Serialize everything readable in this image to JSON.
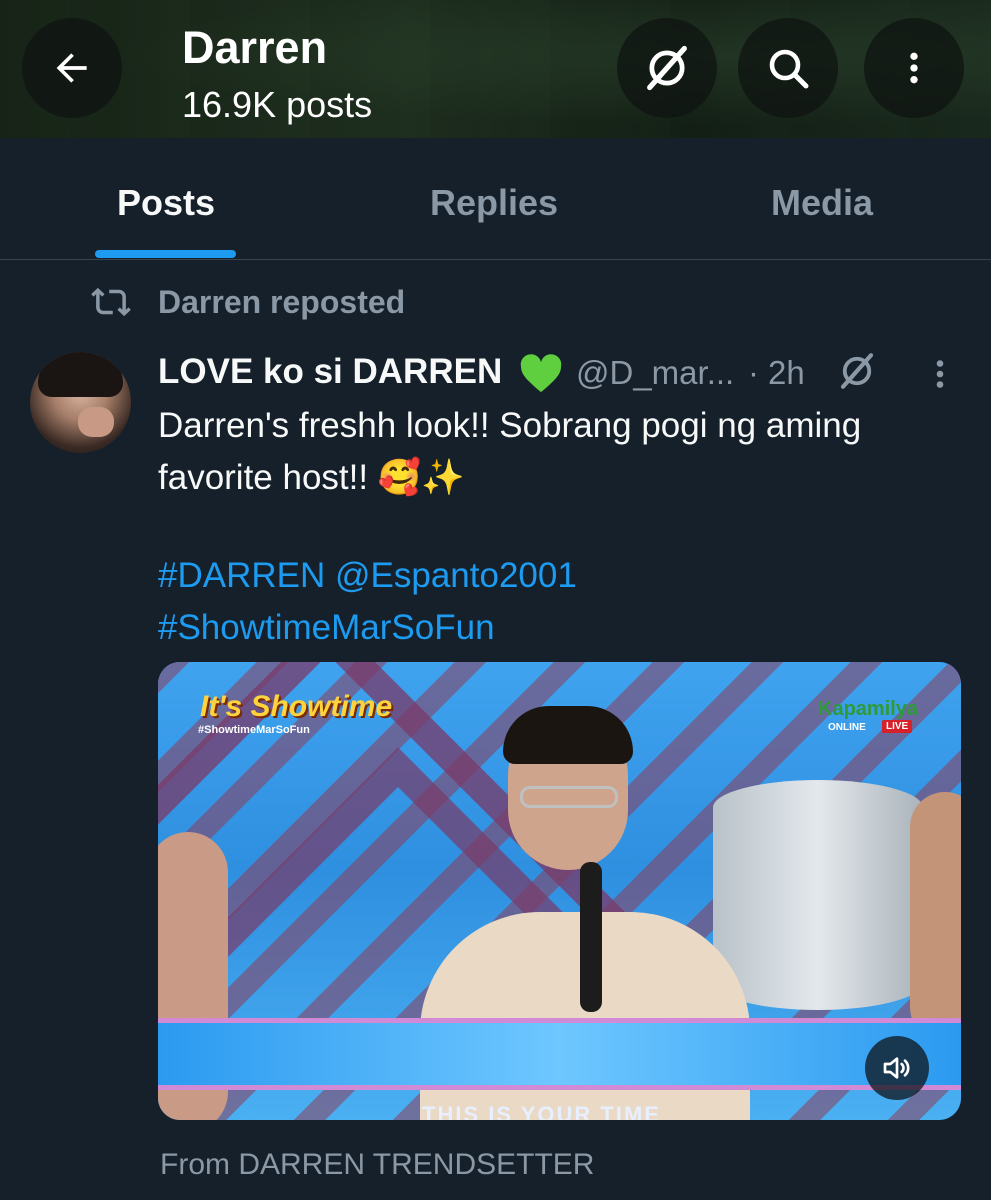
{
  "header": {
    "title": "Darren",
    "subtitle": "16.9K posts"
  },
  "tabs": [
    {
      "label": "Posts"
    },
    {
      "label": "Replies"
    },
    {
      "label": "Media"
    }
  ],
  "repost": {
    "text": "Darren reposted"
  },
  "post": {
    "display_name": "LOVE ko si DARREN",
    "handle": "@D_mar...",
    "separator": "·",
    "time": "2h",
    "text": "Darren's freshh look!! Sobrang pogi ng aming favorite host!! 🥰✨",
    "links_line1": "#DARREN @Espanto2001",
    "links_line2": "#ShowtimeMarSoFun",
    "media": {
      "logo_left": "It's Showtime",
      "logo_left_tag": "#ShowtimeMarSoFun",
      "logo_right": "Kapamilya",
      "logo_right_sub": "ONLINE",
      "logo_live": "LIVE",
      "banner_text": "THIS IS YOUR TIME"
    },
    "source": "From DARREN TRENDSETTER"
  },
  "colors": {
    "background": "#15202b",
    "accent": "#1d9bf0",
    "muted": "#8b98a5",
    "heart": "#5fcf3f"
  }
}
